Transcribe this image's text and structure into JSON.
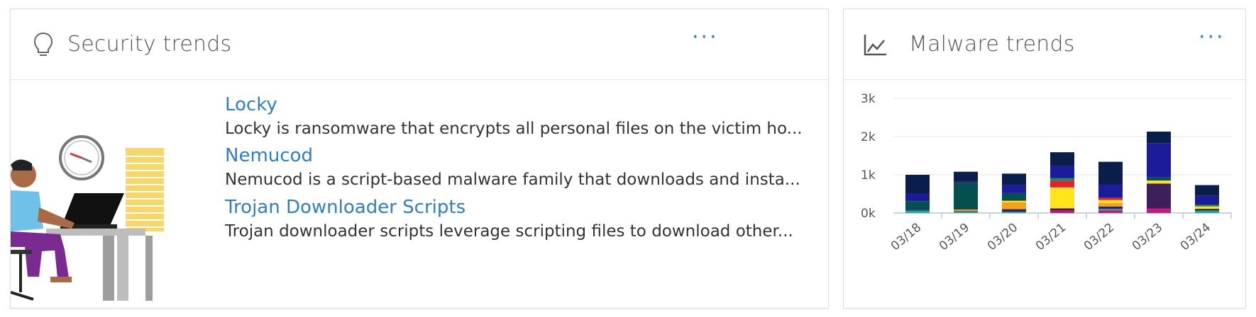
{
  "security_card": {
    "title": "Security trends",
    "icon": "lightbulb-icon",
    "more_label": "···",
    "items": [
      {
        "name": "Locky",
        "description": "Locky is ransomware that encrypts all personal files on the victim ho..."
      },
      {
        "name": "Nemucod",
        "description": "Nemucod is a script-based malware family that downloads and insta..."
      },
      {
        "name": "Trojan Downloader Scripts",
        "description": "Trojan downloader scripts leverage scripting files to download other..."
      }
    ]
  },
  "malware_card": {
    "title": "Malware trends",
    "icon": "line-chart-icon",
    "more_label": "···"
  },
  "chart_data": {
    "type": "bar",
    "stacked": true,
    "categories": [
      "03/18",
      "03/19",
      "03/20",
      "03/21",
      "03/22",
      "03/23",
      "03/24"
    ],
    "y_ticks": [
      "0k",
      "1k",
      "2k",
      "3k"
    ],
    "ylim": [
      0,
      3000
    ],
    "grid": true,
    "series": [
      {
        "color": "#c2187c",
        "values": [
          0,
          0,
          0,
          60,
          70,
          120,
          0
        ]
      },
      {
        "color": "#1fa89a",
        "values": [
          60,
          30,
          30,
          0,
          40,
          0,
          60
        ]
      },
      {
        "color": "#3d1f5c",
        "values": [
          30,
          20,
          70,
          60,
          60,
          650,
          50
        ]
      },
      {
        "color": "#f4a21b",
        "values": [
          0,
          40,
          180,
          0,
          90,
          0,
          0
        ]
      },
      {
        "color": "#ffe51a",
        "values": [
          0,
          0,
          40,
          550,
          80,
          80,
          60
        ]
      },
      {
        "color": "#e5202b",
        "values": [
          0,
          0,
          0,
          180,
          60,
          0,
          0
        ]
      },
      {
        "color": "#1e8a64",
        "values": [
          0,
          0,
          0,
          60,
          0,
          0,
          40
        ]
      },
      {
        "color": "#045050",
        "values": [
          220,
          700,
          200,
          0,
          0,
          80,
          0
        ]
      },
      {
        "color": "#1c1c9a",
        "values": [
          200,
          30,
          220,
          320,
          350,
          900,
          240
        ]
      },
      {
        "color": "#0a1e4a",
        "values": [
          490,
          260,
          290,
          360,
          590,
          300,
          280
        ]
      }
    ]
  }
}
